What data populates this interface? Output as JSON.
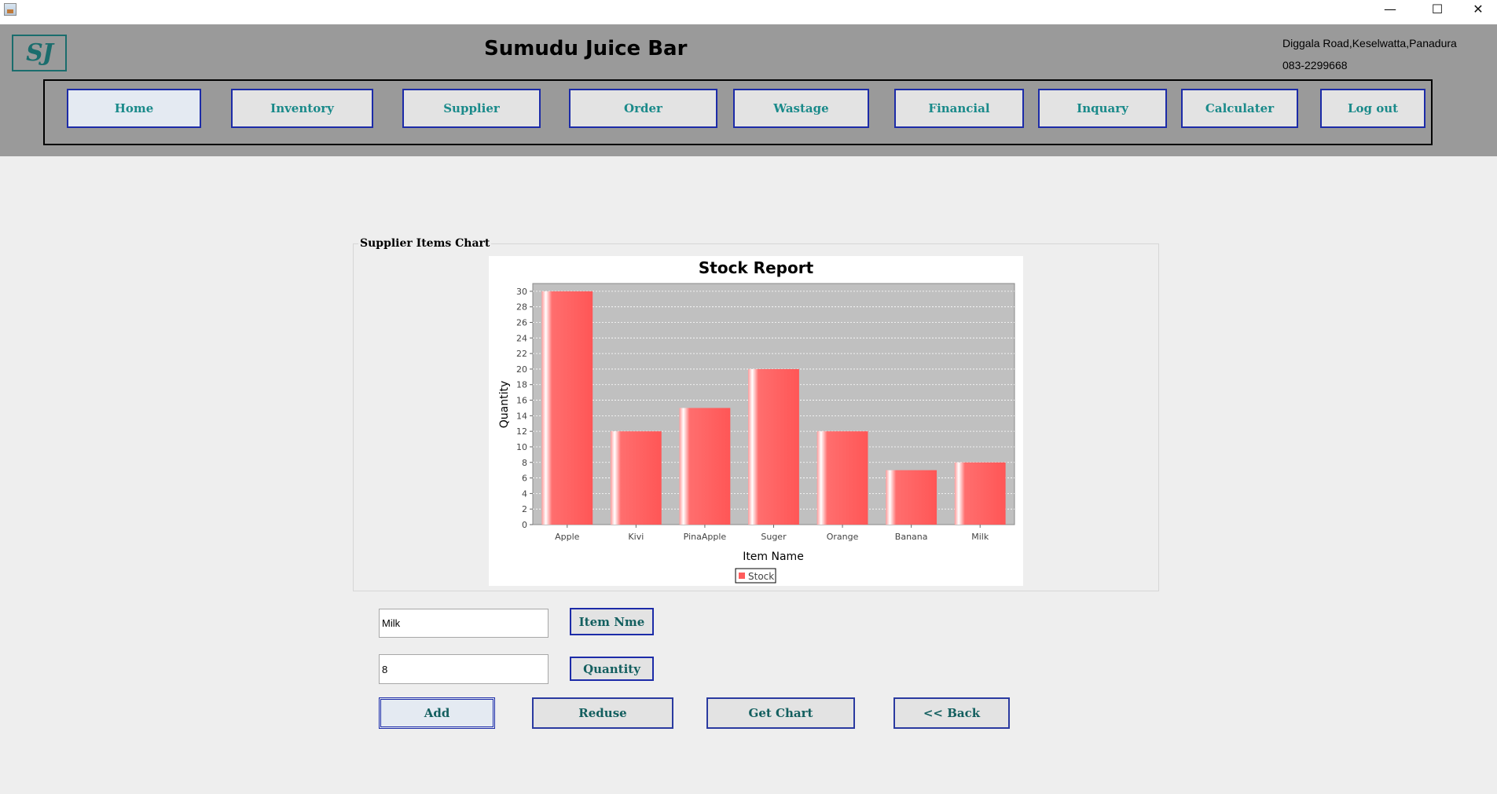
{
  "window": {
    "minimize_glyph": "—",
    "maximize_glyph": "☐",
    "close_glyph": "✕"
  },
  "header": {
    "logo_text": "SJ",
    "shop_name": "Sumudu Juice Bar",
    "address": "Diggala Road,Keselwatta,Panadura",
    "phone": "083-2299668"
  },
  "nav": {
    "home": "Home",
    "inventory": "Inventory",
    "supplier": "Supplier",
    "order": "Order",
    "wastage": "Wastage",
    "financial": "Financial",
    "inquary": "Inquary",
    "calculater": "Calculater",
    "logout": "Log out"
  },
  "panel": {
    "title": "Supplier Items Chart"
  },
  "form": {
    "item_value": "Milk",
    "quantity_value": "8",
    "item_label": "Item Nme",
    "quantity_label": "Quantity"
  },
  "actions": {
    "add": "Add",
    "reduse": "Reduse",
    "get_chart": "Get Chart",
    "back": "<< Back"
  },
  "colors": {
    "bar": "#ff5c5c",
    "plot_bg": "#c0c0c0",
    "button_border": "#1c2ba8",
    "button_text": "#1a8a8a"
  },
  "chart_data": {
    "type": "bar",
    "title": "Stock Report",
    "xlabel": "Item Name",
    "ylabel": "Quantity",
    "categories": [
      "Apple",
      "Kivi",
      "PinaApple",
      "Suger",
      "Orange",
      "Banana",
      "Milk"
    ],
    "series": [
      {
        "name": "Stock",
        "values": [
          30,
          12,
          15,
          20,
          12,
          7,
          8
        ]
      }
    ],
    "ylim": [
      0,
      31
    ],
    "yticks": [
      0,
      2,
      4,
      6,
      8,
      10,
      12,
      14,
      16,
      18,
      20,
      22,
      24,
      26,
      28,
      30
    ],
    "grid": true,
    "legend": "bottom"
  }
}
